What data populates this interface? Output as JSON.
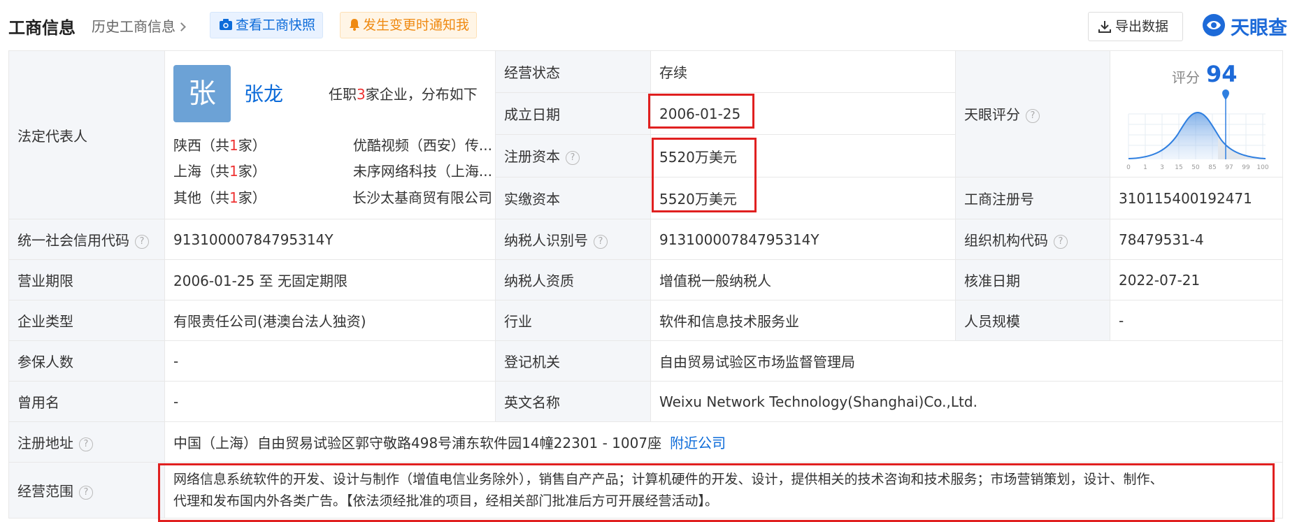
{
  "header": {
    "title": "工商信息",
    "history": "历史工商信息",
    "snapshot_btn": "查看工商快照",
    "notify_btn": "发生变更时通知我",
    "export_btn": "导出数据",
    "logo_text": "天眼查"
  },
  "legal_rep": {
    "label": "法定代表人",
    "avatar_char": "张",
    "name": "张龙",
    "tenure_prefix": "任职",
    "tenure_count": "3",
    "tenure_suffix": "家企业，分布如下",
    "regions": [
      {
        "pre": "陕西（共",
        "count": "1",
        "post": "家）",
        "company": "优酷视频（西安）传..."
      },
      {
        "pre": "上海（共",
        "count": "1",
        "post": "家）",
        "company": "未序网络科技（上海..."
      },
      {
        "pre": "其他（共",
        "count": "1",
        "post": "家）",
        "company": "长沙太基商贸有限公司"
      }
    ]
  },
  "rows": {
    "status_label": "经营状态",
    "status_value": "存续",
    "found_label": "成立日期",
    "found_value": "2006-01-25",
    "capital_label": "注册资本",
    "capital_value": "5520万美元",
    "paid_label": "实缴资本",
    "paid_value": "5520万美元",
    "tianyan_label": "天眼评分",
    "regno_label": "工商注册号",
    "regno_value": "310115400192471",
    "credit_label": "统一社会信用代码",
    "credit_value": "91310000784795314Y",
    "taxid_label": "纳税人识别号",
    "taxid_value": "91310000784795314Y",
    "org_label": "组织机构代码",
    "org_value": "78479531-4",
    "term_label": "营业期限",
    "term_value": "2006-01-25 至 无固定期限",
    "taxq_label": "纳税人资质",
    "taxq_value": "增值税一般纳税人",
    "approve_label": "核准日期",
    "approve_value": "2022-07-21",
    "type_label": "企业类型",
    "type_value": "有限责任公司(港澳台法人独资)",
    "industry_label": "行业",
    "industry_value": "软件和信息技术服务业",
    "staff_label": "人员规模",
    "staff_value": "-",
    "insured_label": "参保人数",
    "insured_value": "-",
    "authority_label": "登记机关",
    "authority_value": "自由贸易试验区市场监督管理局",
    "former_label": "曾用名",
    "former_value": "-",
    "english_label": "英文名称",
    "english_value": "Weixu Network Technology(Shanghai)Co.,Ltd.",
    "address_label": "注册地址",
    "address_value": "中国（上海）自由贸易试验区郭守敬路498号浦东软件园14幢22301 - 1007座",
    "nearby_link": "附近公司",
    "scope_label": "经营范围",
    "scope_line1": "网络信息系统软件的开发、设计与制作（增值电信业务除外），销售自产产品；计算机硬件的开发、设计，提供相关的技术咨询和技术服务；市场营销策划，设计、制作、",
    "scope_line2": "代理和发布国内外各类广告。【依法须经批准的项目，经相关部门批准后方可开展经营活动】。"
  },
  "score": {
    "title": "评分",
    "value": "94",
    "ticks": [
      "0",
      "1",
      "3",
      "15",
      "50",
      "85",
      "97",
      "99",
      "100"
    ]
  },
  "colors": {
    "accent": "#0c6bd9",
    "highlight": "#e02020",
    "label_bg": "#f4f6f9"
  }
}
